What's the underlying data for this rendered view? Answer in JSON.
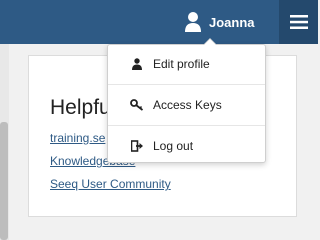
{
  "header": {
    "user_name": "Joanna"
  },
  "card": {
    "title": "Helpfu",
    "links": [
      "training.se",
      "Knowledgebase",
      "Seeq User Community"
    ]
  },
  "user_menu": {
    "items": [
      {
        "label": "Edit profile",
        "icon": "user-icon"
      },
      {
        "label": "Access Keys",
        "icon": "key-icon"
      },
      {
        "label": "Log out",
        "icon": "sign-out-icon"
      }
    ]
  }
}
